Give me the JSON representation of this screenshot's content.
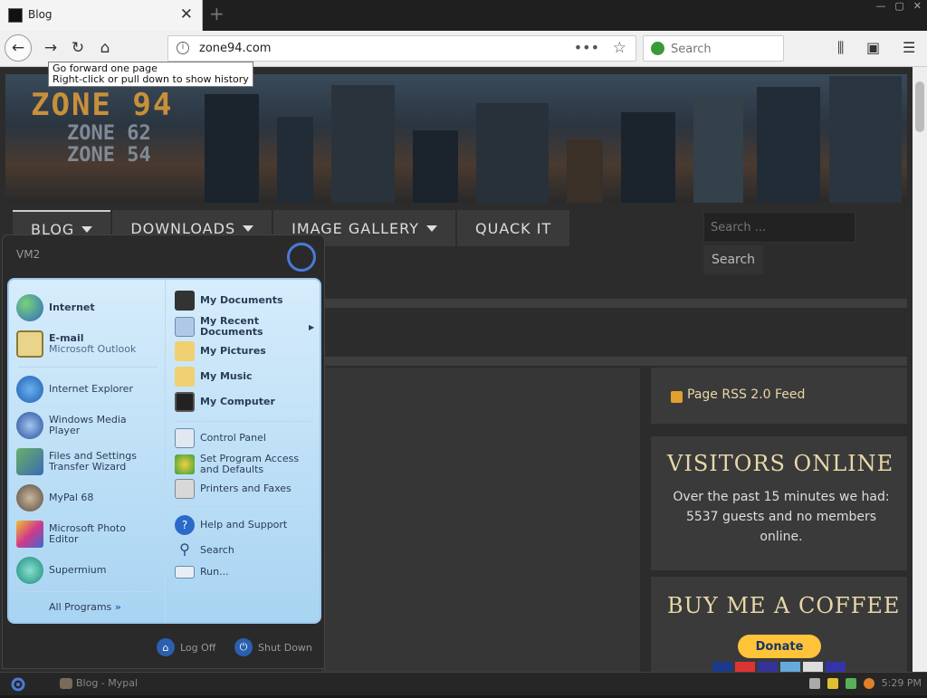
{
  "browser": {
    "tab_title": "Blog",
    "new_tab": "+",
    "url": "zone94.com",
    "search_placeholder": "Search",
    "tooltip_line1": "Go forward one page",
    "tooltip_line2": "Right-click or pull down to show history"
  },
  "site": {
    "logo_main": "ZONE 94",
    "logo_sub1": "ZONE 62",
    "logo_sub2": "ZONE 54",
    "menu": [
      {
        "label": "BLOG",
        "dropdown": true
      },
      {
        "label": "DOWNLOADS",
        "dropdown": true
      },
      {
        "label": "IMAGE GALLERY",
        "dropdown": true
      },
      {
        "label": "QUACK IT",
        "dropdown": false
      }
    ],
    "search_placeholder": "Search ...",
    "search_button": "Search",
    "rss_text": "Page RSS 2.0 Feed",
    "visitors_title": "VISITORS ONLINE",
    "visitors_body": "Over the past 15 minutes we had: 5537 guests and no members online.",
    "coffee_title": "BUY ME A COFFEE",
    "donate_label": "Donate"
  },
  "start_menu": {
    "user": "VM2",
    "left_items": [
      {
        "name": "Internet",
        "sub": "",
        "color": "#2f8a3a"
      },
      {
        "name": "E-mail",
        "sub": "Microsoft Outlook",
        "color": "#d8c070"
      },
      {
        "name": "Internet Explorer",
        "sub": "",
        "color": "#2f73c8"
      },
      {
        "name": "Windows Media Player",
        "sub": "",
        "color": "#3a66c0"
      },
      {
        "name": "Files and Settings Transfer Wizard",
        "sub": "",
        "color": "#4a8a5a"
      },
      {
        "name": "MyPal 68",
        "sub": "",
        "color": "#8a6a4a"
      },
      {
        "name": "Microsoft Photo Editor",
        "sub": "",
        "color": "#b03a8a"
      },
      {
        "name": "Supermium",
        "sub": "",
        "color": "#2a9a8a"
      }
    ],
    "all_programs": "All Programs",
    "right_items": [
      {
        "name": "My Documents",
        "bold": true
      },
      {
        "name": "My Recent Documents",
        "bold": true
      },
      {
        "name": "My Pictures",
        "bold": true
      },
      {
        "name": "My Music",
        "bold": true
      },
      {
        "name": "My Computer",
        "bold": true
      },
      {
        "name": "Control Panel",
        "bold": false
      },
      {
        "name": "Set Program Access and Defaults",
        "bold": false
      },
      {
        "name": "Printers and Faxes",
        "bold": false
      },
      {
        "name": "Help and Support",
        "bold": false
      },
      {
        "name": "Search",
        "bold": false
      },
      {
        "name": "Run...",
        "bold": false
      }
    ],
    "log_off": "Log Off",
    "shut_down": "Shut Down"
  },
  "taskbar": {
    "task": "Blog - Mypal",
    "clock": "5:29 PM"
  }
}
